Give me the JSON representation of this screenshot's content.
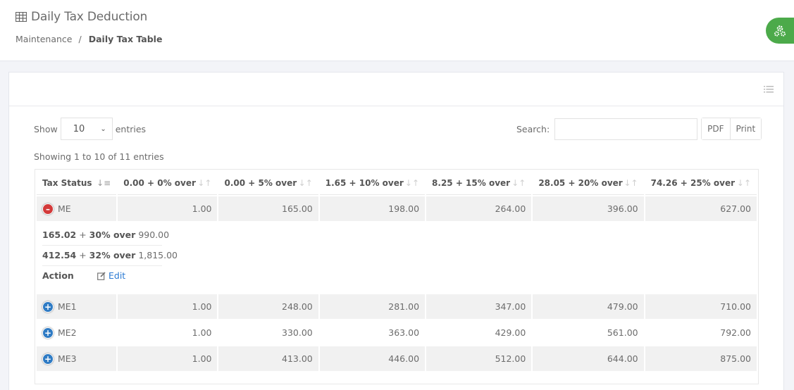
{
  "header": {
    "title": "Daily Tax Deduction",
    "title_icon": "table-icon",
    "breadcrumb": [
      {
        "label": "Maintenance"
      },
      {
        "label": "Daily Tax Table"
      }
    ],
    "breadcrumb_separator": "/"
  },
  "fab": {
    "icon": "gears-icon",
    "color": "#4caa4a"
  },
  "toolbar": {
    "show_label": "Show",
    "entries_value": "10",
    "entries_label": "entries",
    "search_label": "Search:",
    "search_value": "",
    "pdf_label": "PDF",
    "print_label": "Print"
  },
  "info": "Showing 1 to 10 of 11 entries",
  "table": {
    "columns": [
      "Tax Status",
      "0.00 + 0% over",
      "0.00 + 5% over",
      "1.65 + 10% over",
      "8.25 + 15% over",
      "28.05 + 20% over",
      "74.26 + 25% over"
    ],
    "rows": [
      {
        "status": "ME",
        "expanded": true,
        "values": [
          "1.00",
          "165.00",
          "198.00",
          "264.00",
          "396.00",
          "627.00"
        ]
      },
      {
        "status": "ME1",
        "expanded": false,
        "values": [
          "1.00",
          "248.00",
          "281.00",
          "347.00",
          "479.00",
          "710.00"
        ]
      },
      {
        "status": "ME2",
        "expanded": false,
        "values": [
          "1.00",
          "330.00",
          "363.00",
          "429.00",
          "561.00",
          "792.00"
        ]
      },
      {
        "status": "ME3",
        "expanded": false,
        "values": [
          "1.00",
          "413.00",
          "446.00",
          "512.00",
          "644.00",
          "875.00"
        ]
      }
    ],
    "child": {
      "items": [
        {
          "label": "165.02",
          "op": " + ",
          "pct": "30% over",
          "value": "990.00"
        },
        {
          "label": "412.54",
          "op": " + ",
          "pct": "32% over",
          "value": "1,815.00"
        }
      ],
      "action_label": "Action",
      "edit_label": "Edit"
    }
  },
  "colors": {
    "expand_minus": "#d33a3a",
    "expand_plus": "#2f7bc4",
    "link": "#2a7ad3"
  }
}
